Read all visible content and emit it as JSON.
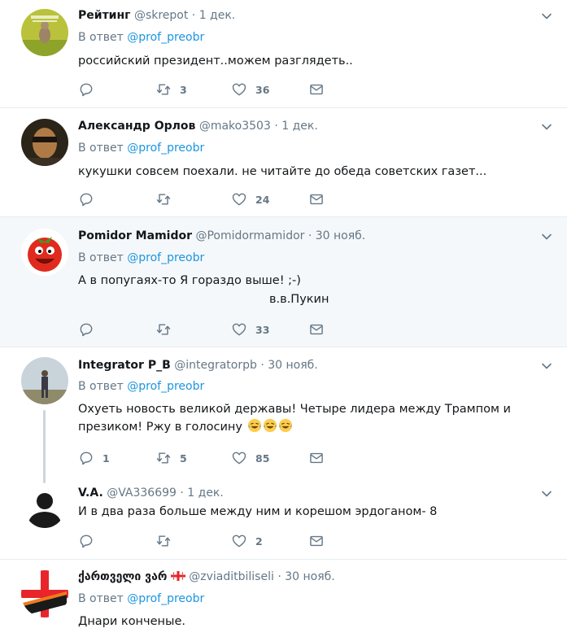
{
  "reply_prefix": "В ответ",
  "tweets": [
    {
      "name": "Рейтинг",
      "handle": "@skrepot",
      "dot": "·",
      "time": "1 дек.",
      "reply_to": "@prof_preobr",
      "text": "российский президент..можем разглядеть..",
      "counts": {
        "reply": "",
        "retweet": "3",
        "like": "36"
      }
    },
    {
      "name": "Александр Орлов",
      "handle": "@mako3503",
      "dot": "·",
      "time": "1 дек.",
      "reply_to": "@prof_preobr",
      "text": "кукушки совсем поехали. не читайте до обеда советских газет...",
      "counts": {
        "reply": "",
        "retweet": "",
        "like": "24"
      }
    },
    {
      "name": "Pomidor Mamidor",
      "handle": "@Pomidormamidor",
      "dot": "·",
      "time": "30 нояб.",
      "reply_to": "@prof_preobr",
      "text": "А в попугаях-то Я гораздо выше! ;-)",
      "signature": "в.в.Пукин",
      "counts": {
        "reply": "",
        "retweet": "",
        "like": "33"
      }
    },
    {
      "name": "Integrator P_B",
      "handle": "@integratorpb",
      "dot": "·",
      "time": "30 нояб.",
      "reply_to": "@prof_preobr",
      "text_line1": "Охуеть новость великой державы! Четыре лидера между Трампом и",
      "text_line2": "презиком! Ржу в голосину",
      "counts": {
        "reply": "1",
        "retweet": "5",
        "like": "85"
      }
    },
    {
      "name": "V.A.",
      "handle": "@VA336699",
      "dot": "·",
      "time": "1 дек.",
      "text": "И в два раза больше между ним и корешом эрдоганом- 8",
      "counts": {
        "reply": "",
        "retweet": "",
        "like": "2"
      }
    },
    {
      "name": "ქართველი ვარ",
      "handle": "@zviaditbiliseli",
      "dot": "·",
      "time": "30 нояб.",
      "reply_to": "@prof_preobr",
      "text": "Днари конченые."
    }
  ],
  "colors": {
    "link": "#1b95e0",
    "muted": "#657786",
    "border": "#e6ecf0",
    "highlight": "#f5f8fa"
  }
}
